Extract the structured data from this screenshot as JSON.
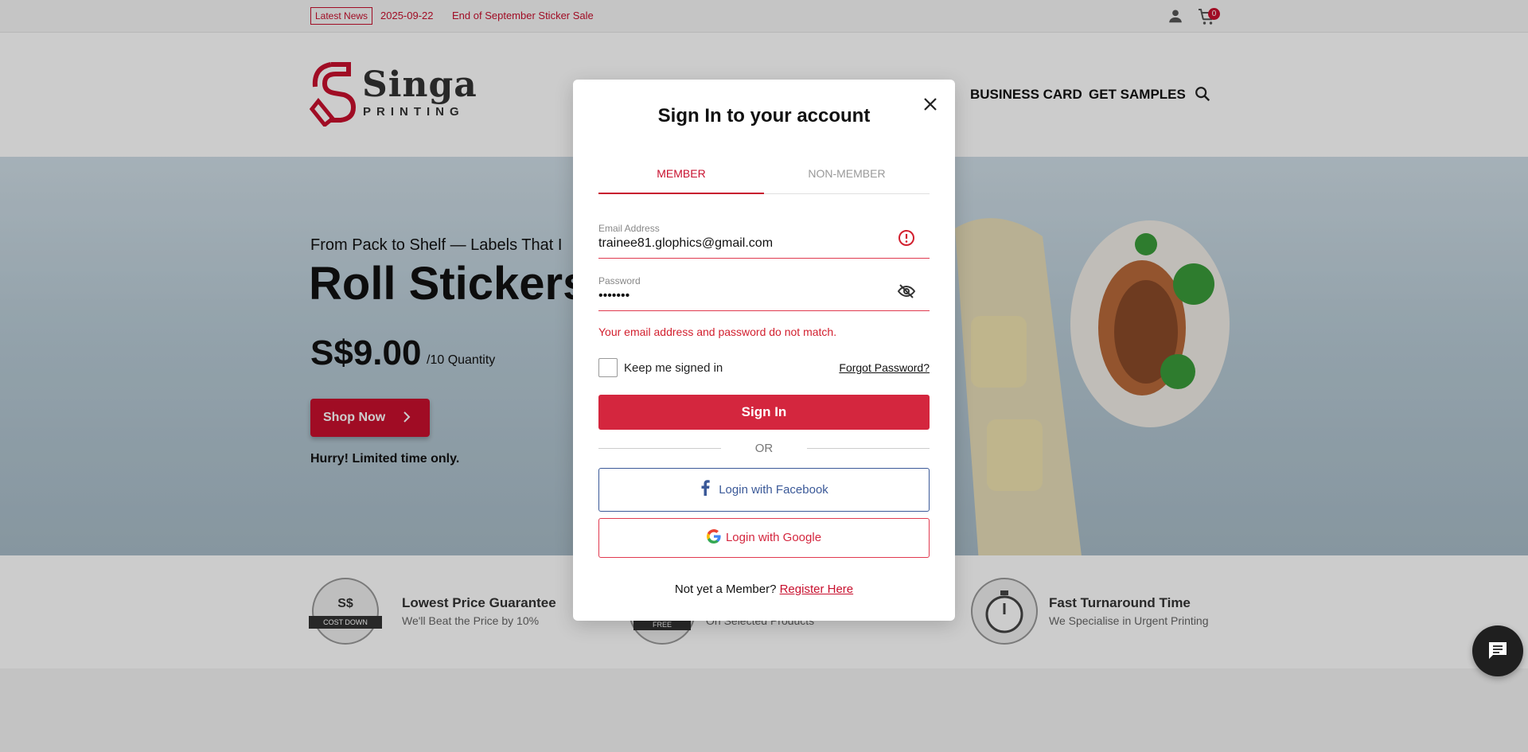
{
  "newsbar": {
    "tag": "Latest News",
    "date": "2025-09-22",
    "headline": "End of September Sticker Sale",
    "cart_count": "0"
  },
  "header": {
    "logo_word": "Singa",
    "logo_sub": "PRINTING",
    "nav": [
      "BUSINESS CARD",
      "GET SAMPLES"
    ]
  },
  "hero": {
    "subtitle": "From Pack to Shelf — Labels That I",
    "title": "Roll Stickers",
    "price": "S$9.00",
    "qty_label": "/10 Quantity",
    "cta": "Shop Now",
    "note": "Hurry! Limited time only."
  },
  "features": [
    {
      "title": "Lowest Price Guarantee",
      "desc": "We'll Beat the Price by 10%",
      "badge_line1": "S$",
      "badge_line2": "COST DOWN"
    },
    {
      "title": "",
      "desc": "On Selected Products",
      "badge_line1": "FREE",
      "badge_line2": ""
    },
    {
      "title": "Fast Turnaround Time",
      "desc": "We Specialise in Urgent Printing",
      "badge_line1": "",
      "badge_line2": ""
    }
  ],
  "modal": {
    "title": "Sign In to your account",
    "tabs": [
      "MEMBER",
      "NON-MEMBER"
    ],
    "email_label": "Email Address",
    "email_value": "trainee81.glophics@gmail.com",
    "password_label": "Password",
    "password_value": "•••••••",
    "error": "Your email address and password do not match.",
    "keep_signed_in": "Keep me signed in",
    "forgot": "Forgot Password?",
    "signin": "Sign In",
    "or": "OR",
    "facebook": "Login with Facebook",
    "google": "Login with Google",
    "not_member": "Not yet a Member?",
    "register": "Register Here"
  },
  "colors": {
    "brand": "#c8102e",
    "signin_button": "#d4263e",
    "facebook": "#3b5998"
  },
  "icons": [
    "user-icon",
    "cart-icon",
    "search-icon",
    "close-icon",
    "alert-circle-icon",
    "eye-off-icon",
    "facebook-icon",
    "google-icon",
    "chat-icon",
    "chevron-right-icon"
  ]
}
